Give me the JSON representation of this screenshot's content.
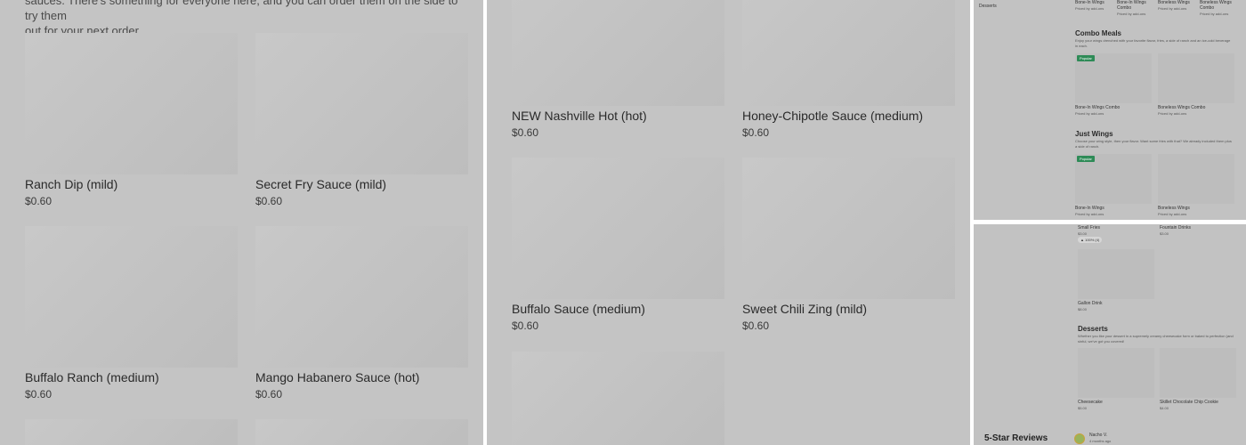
{
  "left_panel": {
    "intro_lines": [
      "sauces. There's something for everyone here, and you can order them on the side to try them",
      "out for your next order."
    ],
    "items": [
      {
        "name": "Ranch Dip (mild)",
        "price": "$0.60"
      },
      {
        "name": "Secret Fry Sauce (mild)",
        "price": "$0.60"
      },
      {
        "name": "Buffalo Ranch (medium)",
        "price": "$0.60"
      },
      {
        "name": "Mango Habanero Sauce (hot)",
        "price": "$0.60"
      }
    ]
  },
  "mid_panel": {
    "items": [
      {
        "name": "NEW Nashville Hot (hot)",
        "price": "$0.60"
      },
      {
        "name": "Honey-Chipotle Sauce (medium)",
        "price": "$0.60"
      },
      {
        "name": "Buffalo Sauce (medium)",
        "price": "$0.60"
      },
      {
        "name": "Sweet Chili Zing (mild)",
        "price": "$0.60"
      }
    ]
  },
  "right_top": {
    "sidebar_label": "Desserts",
    "top_items": [
      {
        "name": "Bone-In Wings",
        "sub": "Priced by add-ons"
      },
      {
        "name": "Bone-In Wings Combo",
        "sub": "Priced by add-ons"
      },
      {
        "name": "Boneless Wings",
        "sub": "Priced by add-ons"
      },
      {
        "name": "Boneless Wings Combo",
        "sub": "Priced by add-ons"
      }
    ],
    "sections": [
      {
        "title": "Combo Meals",
        "desc": "Enjoy your wings drenched with your favorite flavor, fries, a side of ranch and an ice-cold beverage in each.",
        "badge": "Popular",
        "items": [
          {
            "name": "Bone-In Wings Combo",
            "sub": "Priced by add-ons"
          },
          {
            "name": "Boneless Wings Combo",
            "sub": "Priced by add-ons"
          }
        ]
      },
      {
        "title": "Just Wings",
        "desc": "Choose your wing style, then your flavor. Want some fries with that? We already included them plus a side of ranch.",
        "badge": "Popular",
        "items": [
          {
            "name": "Bone-In Wings",
            "sub": "Priced by add-ons"
          },
          {
            "name": "Boneless Wings",
            "sub": "Priced by add-ons"
          }
        ]
      }
    ]
  },
  "right_bottom": {
    "top_items": [
      {
        "name": "Small Fries",
        "price": "$3.00",
        "rating": "100% (4)"
      },
      {
        "name": "Fountain Drinks",
        "price": "$3.00"
      }
    ],
    "gallon": {
      "name": "Gallon Drink",
      "price": "$8.00"
    },
    "desserts": {
      "title": "Desserts",
      "desc": "Whether you like your dessert in a supremely creamy cheesecake form or baked to perfection (and sinful, we've got you covered!",
      "items": [
        {
          "name": "Cheesecake",
          "price": "$5.00"
        },
        {
          "name": "Skillet Chocolate Chip Cookie",
          "price": "$4.00"
        }
      ]
    },
    "reviews": {
      "title": "5-Star Reviews",
      "reviewer": "Nacho V.",
      "time": "4 months ago"
    }
  }
}
